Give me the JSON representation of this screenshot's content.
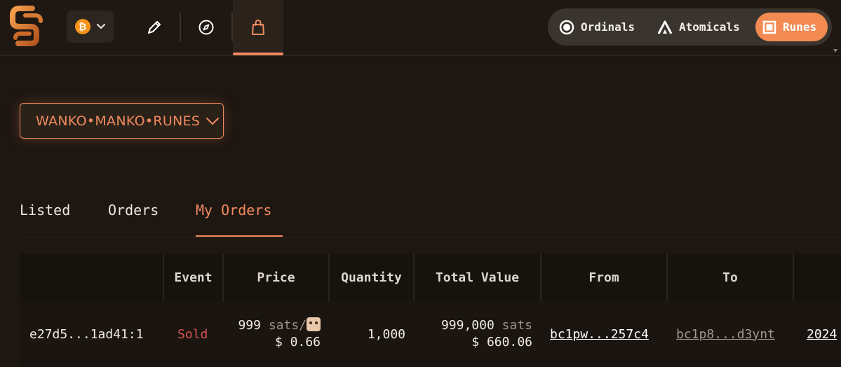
{
  "header": {
    "chain_symbol": "₿",
    "protocols": [
      {
        "label": "Ordinals",
        "icon": "radio-dot-icon"
      },
      {
        "label": "Atomicals",
        "icon": "atomicals-icon"
      },
      {
        "label": "Runes",
        "icon": "square-icon",
        "active": true
      }
    ]
  },
  "rune_selector": {
    "value": "WANKO•MANKO•RUNES"
  },
  "tabs": [
    {
      "label": "Listed"
    },
    {
      "label": "Orders"
    },
    {
      "label": "My Orders",
      "active": true
    }
  ],
  "table": {
    "columns": [
      "",
      "Event",
      "Price",
      "Quantity",
      "Total Value",
      "From",
      "To",
      ""
    ],
    "rows": [
      {
        "outpoint": "e27d5...1ad41:1",
        "event": "Sold",
        "price_sats": "999",
        "price_unit": "sats/",
        "price_usd": "$ 0.66",
        "quantity": "1,000",
        "total_sats": "999,000",
        "total_unit": "sats",
        "total_usd": "$ 660.06",
        "from": "bc1pw...257c4",
        "to": "bc1p8...d3ynt",
        "date": "2024"
      }
    ]
  },
  "colors": {
    "accent": "#f08a5d",
    "background": "#1d1611",
    "sold": "#d9534f",
    "bitcoin": "#f7931a"
  }
}
